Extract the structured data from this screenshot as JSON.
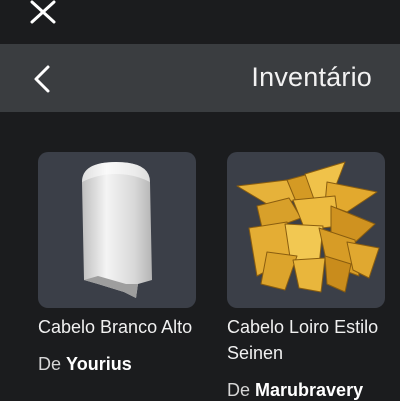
{
  "topbar": {
    "close_icon": "close-icon"
  },
  "header": {
    "title": "Inventário",
    "back_icon": "chevron-left-icon"
  },
  "items": [
    {
      "name": "Cabelo Branco Alto",
      "creator_prefix": "De",
      "creator": "Yourius",
      "thumb_color": "#3b3f48",
      "item_color": "#e6e6e6"
    },
    {
      "name": "Cabelo Loiro Estilo Seinen",
      "creator_prefix": "De",
      "creator": "Marubravery",
      "thumb_color": "#3b3f48",
      "item_color": "#e0aa2c"
    }
  ],
  "colors": {
    "background": "#1b1c1e",
    "header": "#3a3d40",
    "card": "#3b3f48"
  }
}
